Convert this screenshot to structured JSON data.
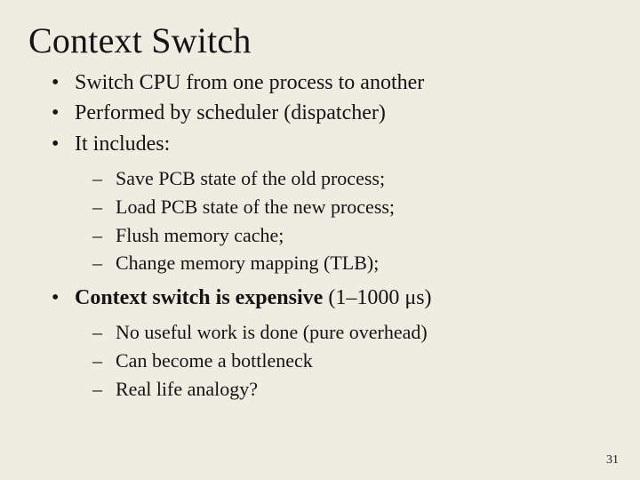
{
  "slide": {
    "title": "Context Switch",
    "page_number": "31",
    "bullets": {
      "b1": "Switch CPU from one process to another",
      "b2": "Performed by scheduler (dispatcher)",
      "b3": "It includes:",
      "b3_sub": {
        "s1": "Save PCB state of the old process;",
        "s2": "Load PCB state of the new process;",
        "s3": "Flush memory cache;",
        "s4": "Change memory mapping (TLB);"
      },
      "b4_strong": "Context switch is expensive",
      "b4_tail": " (1–1000 μs)",
      "b4_sub": {
        "s1": "No useful work is done (pure overhead)",
        "s2": "Can become a bottleneck",
        "s3": "Real life analogy?"
      }
    }
  }
}
